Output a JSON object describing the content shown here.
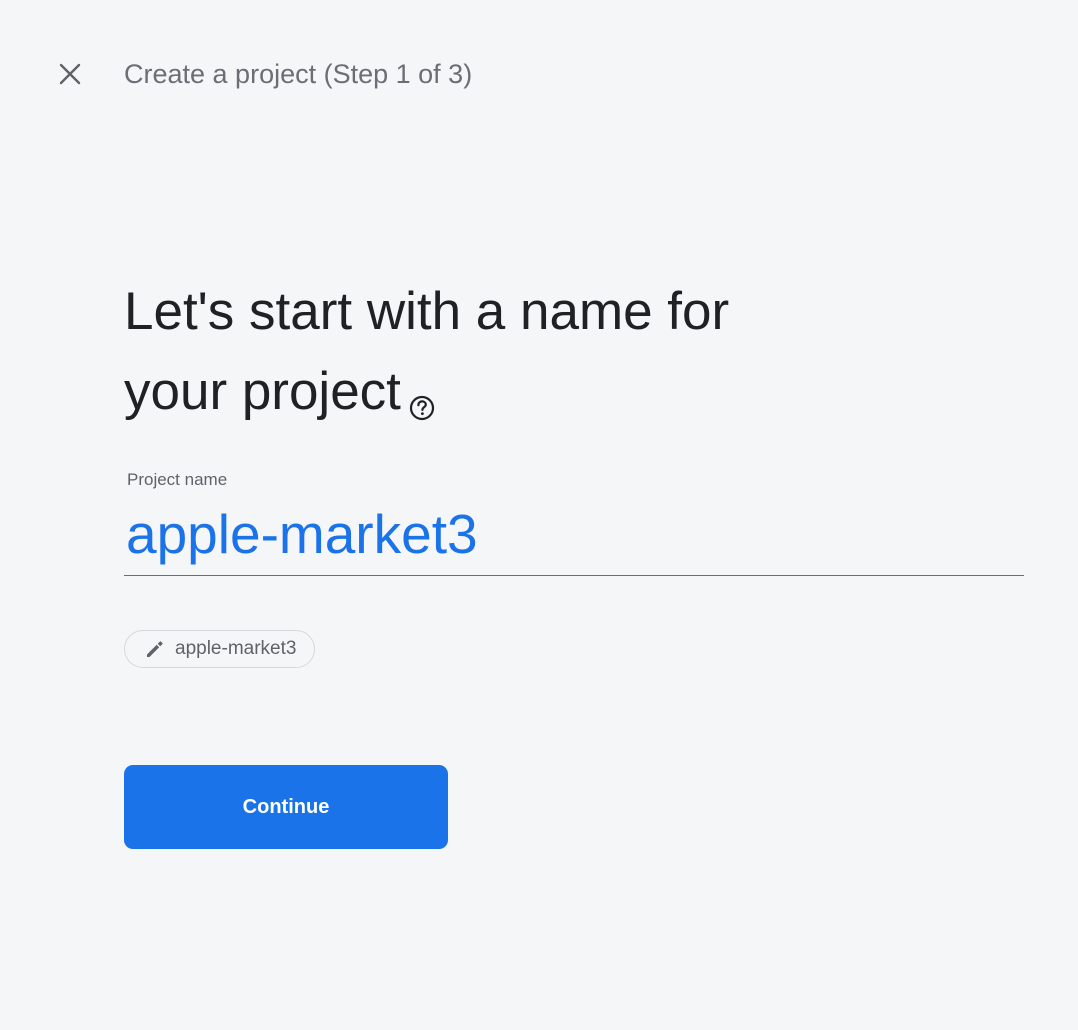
{
  "header": {
    "close_icon": "close-icon",
    "title": "Create a project (Step 1 of 3)"
  },
  "main": {
    "heading_line1": "Let's start with a name for",
    "heading_line2": "your project",
    "help_icon": "help-circle-icon",
    "project_name_label": "Project name",
    "project_name_value": "apple-market3",
    "project_id_chip": {
      "icon": "pencil-icon",
      "label": "apple-market3"
    },
    "continue_label": "Continue"
  },
  "colors": {
    "background": "#f5f6f8",
    "accent": "#1a73e8",
    "input_underline": "#2a7fc4",
    "text_primary": "#202124",
    "text_secondary": "#5f6368"
  }
}
